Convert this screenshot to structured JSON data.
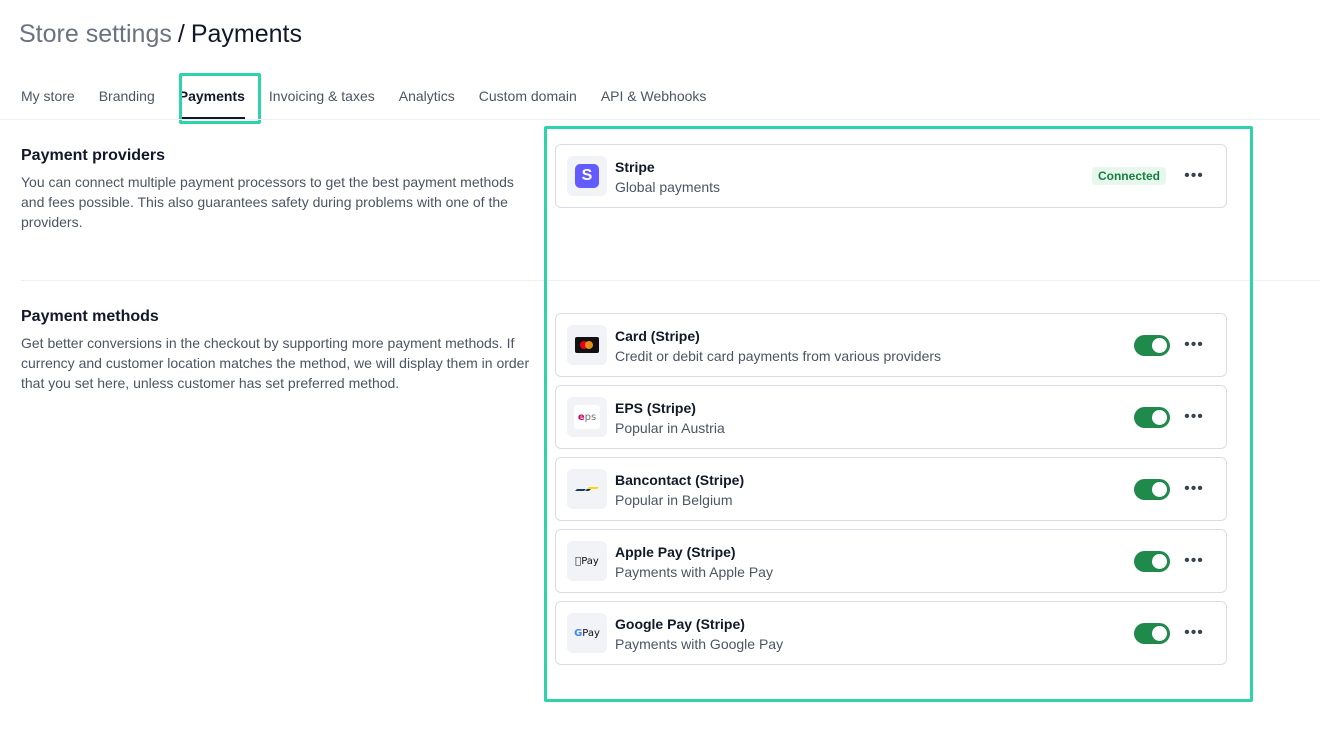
{
  "header": {
    "crumb": "Store settings",
    "separator": "/",
    "current": "Payments"
  },
  "tabs": [
    {
      "label": "My store"
    },
    {
      "label": "Branding"
    },
    {
      "label": "Payments",
      "active": true
    },
    {
      "label": "Invoicing & taxes"
    },
    {
      "label": "Analytics"
    },
    {
      "label": "Custom domain"
    },
    {
      "label": "API & Webhooks"
    }
  ],
  "providers_section": {
    "title": "Payment providers",
    "description": "You can connect multiple payment processors to get the best payment methods and fees possible. This also guarantees safety during problems with one of the providers."
  },
  "methods_section": {
    "title": "Payment methods",
    "description": "Get better conversions in the checkout by supporting more payment methods. If currency and customer location matches the method, we will display them in order that you set here, unless customer has set preferred method."
  },
  "providers": [
    {
      "name": "Stripe",
      "description": "Global payments",
      "status": "Connected",
      "icon": "stripe-icon",
      "logo_text": "S"
    }
  ],
  "methods": [
    {
      "name": "Card (Stripe)",
      "description": "Credit or debit card payments from various providers",
      "enabled": true,
      "icon": "mastercard-icon"
    },
    {
      "name": "EPS (Stripe)",
      "description": "Popular in Austria",
      "enabled": true,
      "icon": "eps-icon",
      "logo_text_a": "e",
      "logo_text_b": "ps"
    },
    {
      "name": "Bancontact (Stripe)",
      "description": "Popular in Belgium",
      "enabled": true,
      "icon": "bancontact-icon"
    },
    {
      "name": "Apple Pay (Stripe)",
      "description": "Payments with Apple Pay",
      "enabled": true,
      "icon": "apple-pay-icon",
      "logo_text": "Pay"
    },
    {
      "name": "Google Pay (Stripe)",
      "description": "Payments with Google Pay",
      "enabled": true,
      "icon": "google-pay-icon",
      "logo_text": "Pay"
    }
  ],
  "more_label": "•••",
  "colors": {
    "accent_highlight": "#2dd4a9",
    "toggle_on": "#1f8a4c",
    "stripe": "#635bff",
    "connected_text": "#15803d"
  }
}
